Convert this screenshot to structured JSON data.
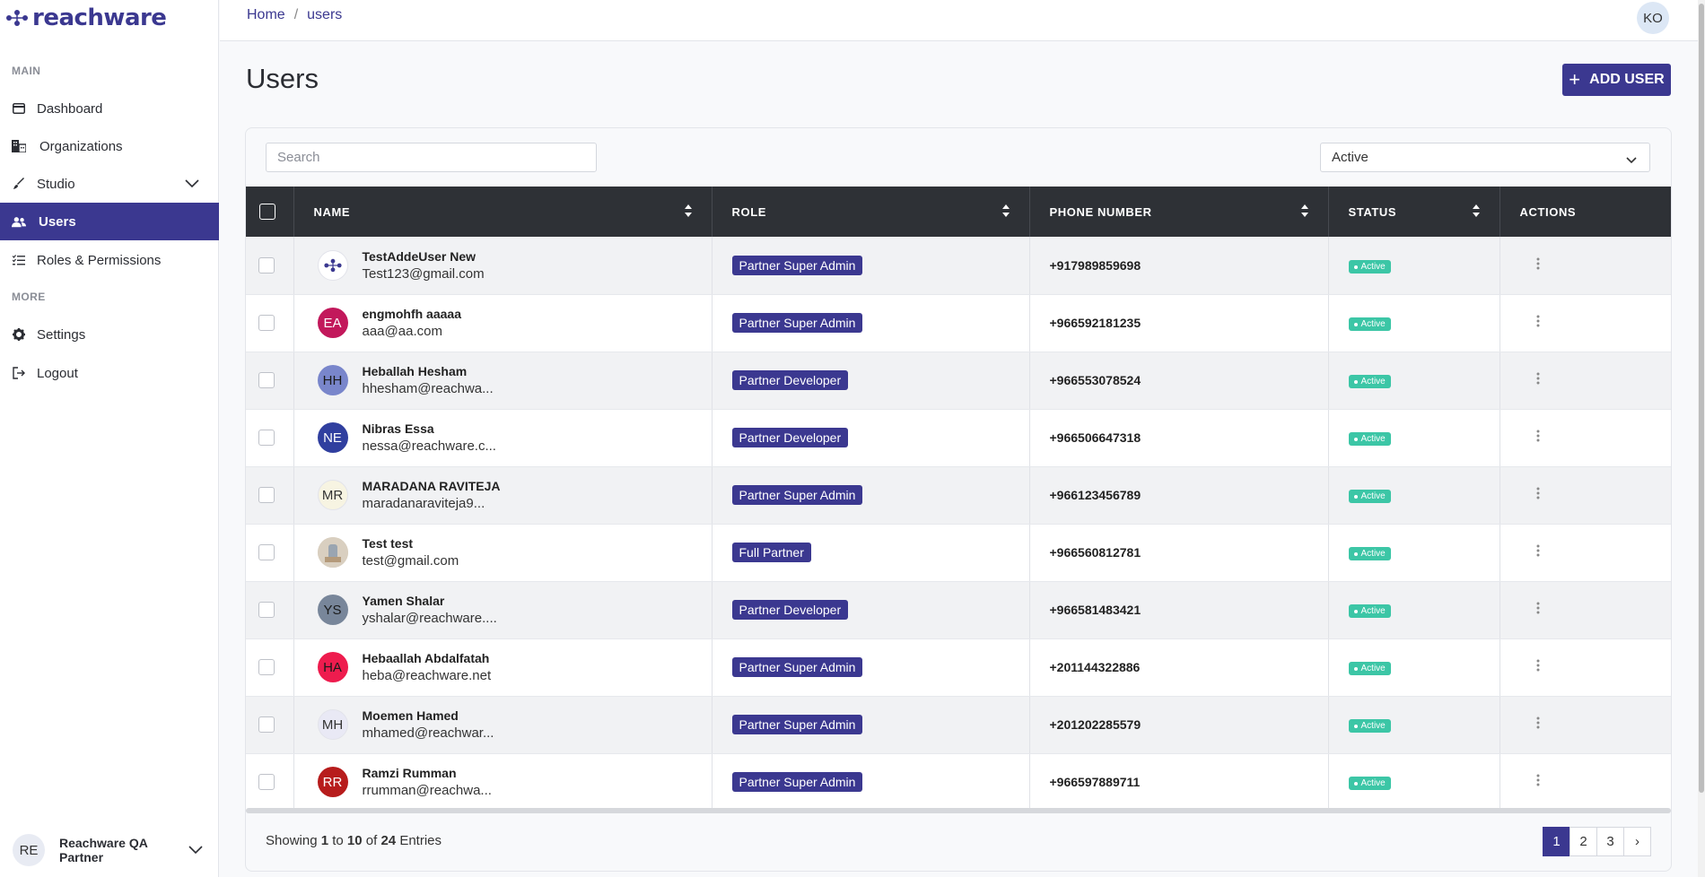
{
  "brand": {
    "name": "reachware"
  },
  "sidebar": {
    "main_label": "MAIN",
    "more_label": "MORE",
    "items": [
      {
        "label": "Dashboard",
        "icon": "dashboard-icon"
      },
      {
        "label": "Organizations",
        "icon": "organizations-icon"
      },
      {
        "label": "Studio",
        "icon": "brush-icon"
      },
      {
        "label": "Users",
        "icon": "users-icon"
      },
      {
        "label": "Roles & Permissions",
        "icon": "checklist-icon"
      }
    ],
    "more_items": [
      {
        "label": "Settings",
        "icon": "gear-icon"
      },
      {
        "label": "Logout",
        "icon": "logout-icon"
      }
    ],
    "org": {
      "initials": "RE",
      "name": "Reachware QA Partner"
    }
  },
  "header": {
    "breadcrumb": {
      "home": "Home",
      "sep": "/",
      "current": "users"
    },
    "user_initials": "KO"
  },
  "page": {
    "title": "Users",
    "add_button": "ADD USER",
    "search_placeholder": "Search",
    "status_filter": "Active"
  },
  "table": {
    "columns": [
      "NAME",
      "ROLE",
      "PHONE NUMBER",
      "STATUS",
      "ACTIONS"
    ],
    "rows": [
      {
        "name": "TestAddeUser New",
        "email": "Test123@gmail.com",
        "initials": "",
        "avatar_bg": "#ffffff",
        "avatar_fg": "#3b3890",
        "role": "Partner Super Admin",
        "phone": "+917989859698",
        "status": "Active"
      },
      {
        "name": "engmohfh aaaaa",
        "email": "aaa@aa.com",
        "initials": "EA",
        "avatar_bg": "#c2185b",
        "avatar_fg": "#ffffff",
        "role": "Partner Super Admin",
        "phone": "+966592181235",
        "status": "Active"
      },
      {
        "name": "Heballah Hesham",
        "email": "hhesham@reachwa...",
        "initials": "HH",
        "avatar_bg": "#7986cb",
        "avatar_fg": "#1a1a1a",
        "role": "Partner Developer",
        "phone": "+966553078524",
        "status": "Active"
      },
      {
        "name": "Nibras Essa",
        "email": "nessa@reachware.c...",
        "initials": "NE",
        "avatar_bg": "#303f9f",
        "avatar_fg": "#ffffff",
        "role": "Partner Developer",
        "phone": "+966506647318",
        "status": "Active"
      },
      {
        "name": "MARADANA RAVITEJA",
        "email": "maradanaraviteja9...",
        "initials": "MR",
        "avatar_bg": "#f7f4e2",
        "avatar_fg": "#333333",
        "role": "Partner Super Admin",
        "phone": "+966123456789",
        "status": "Active"
      },
      {
        "name": "Test test",
        "email": "test@gmail.com",
        "initials": "",
        "avatar_bg": "#d9cfc0",
        "avatar_fg": "#333333",
        "role": "Full Partner",
        "phone": "+966560812781",
        "status": "Active"
      },
      {
        "name": "Yamen Shalar",
        "email": "yshalar@reachware....",
        "initials": "YS",
        "avatar_bg": "#78869a",
        "avatar_fg": "#1a1a1a",
        "role": "Partner Developer",
        "phone": "+966581483421",
        "status": "Active"
      },
      {
        "name": "Hebaallah Abdalfatah",
        "email": "heba@reachware.net",
        "initials": "HA",
        "avatar_bg": "#ee1c4e",
        "avatar_fg": "#1a1a1a",
        "role": "Partner Super Admin",
        "phone": "+201144322886",
        "status": "Active"
      },
      {
        "name": "Moemen Hamed",
        "email": "mhamed@reachwar...",
        "initials": "MH",
        "avatar_bg": "#e9e9f5",
        "avatar_fg": "#333333",
        "role": "Partner Super Admin",
        "phone": "+201202285579",
        "status": "Active"
      },
      {
        "name": "Ramzi Rumman",
        "email": "rrumman@reachwa...",
        "initials": "RR",
        "avatar_bg": "#b71c1c",
        "avatar_fg": "#ffffff",
        "role": "Partner Super Admin",
        "phone": "+966597889711",
        "status": "Active"
      }
    ]
  },
  "footer": {
    "showing": "Showing",
    "from": "1",
    "to_word": "to",
    "to": "10",
    "of_word": "of",
    "total": "24",
    "entries": "Entries",
    "pages": [
      "1",
      "2",
      "3"
    ],
    "next": "›"
  },
  "colors": {
    "primary": "#3b3890",
    "header_dark": "#2e3136",
    "status_active": "#3cc6a6"
  }
}
